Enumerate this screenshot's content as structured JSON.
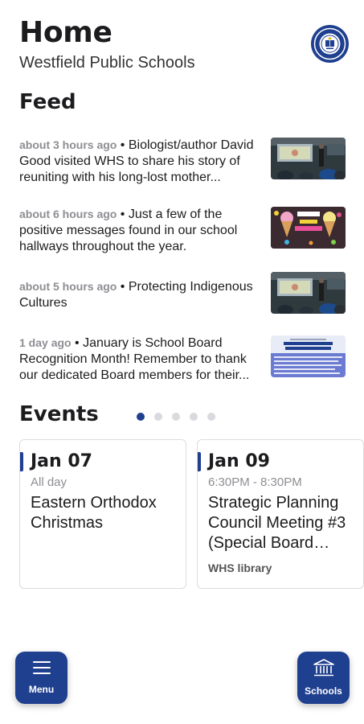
{
  "header": {
    "title": "Home",
    "district": "Westfield Public Schools",
    "logo_icon": "district-seal-icon"
  },
  "feed": {
    "heading": "Feed",
    "items": [
      {
        "time": "about 3 hours ago",
        "separator": " • ",
        "text": "Biologist/author David Good visited WHS to share his story of reuniting with his long-lost mother..."
      },
      {
        "time": "about 6 hours ago",
        "separator": " • ",
        "text": "Just a few of the positive messages found in our school hallways throughout the year."
      },
      {
        "time": "about 5 hours ago",
        "separator": " • ",
        "text": "Protecting Indigenous Cultures"
      },
      {
        "time": "1 day ago",
        "separator": " • ",
        "text": "January is School Board Recognition Month! Remember to thank our dedicated Board members for their..."
      }
    ]
  },
  "events": {
    "heading": "Events",
    "page_count": 5,
    "active_page": 1,
    "cards": [
      {
        "date": "Jan 07",
        "time": "All day",
        "title": "Eastern Orthodox Christmas",
        "location": ""
      },
      {
        "date": "Jan 09",
        "time": "6:30PM - 8:30PM",
        "title": "Strategic Planning Council Meeting #3 (Special Board Meeting)",
        "location": "WHS library"
      }
    ]
  },
  "bottom": {
    "menu_label": "Menu",
    "schools_label": "Schools"
  },
  "colors": {
    "accent": "#1f3f8f",
    "muted_text": "#8e8e93"
  }
}
